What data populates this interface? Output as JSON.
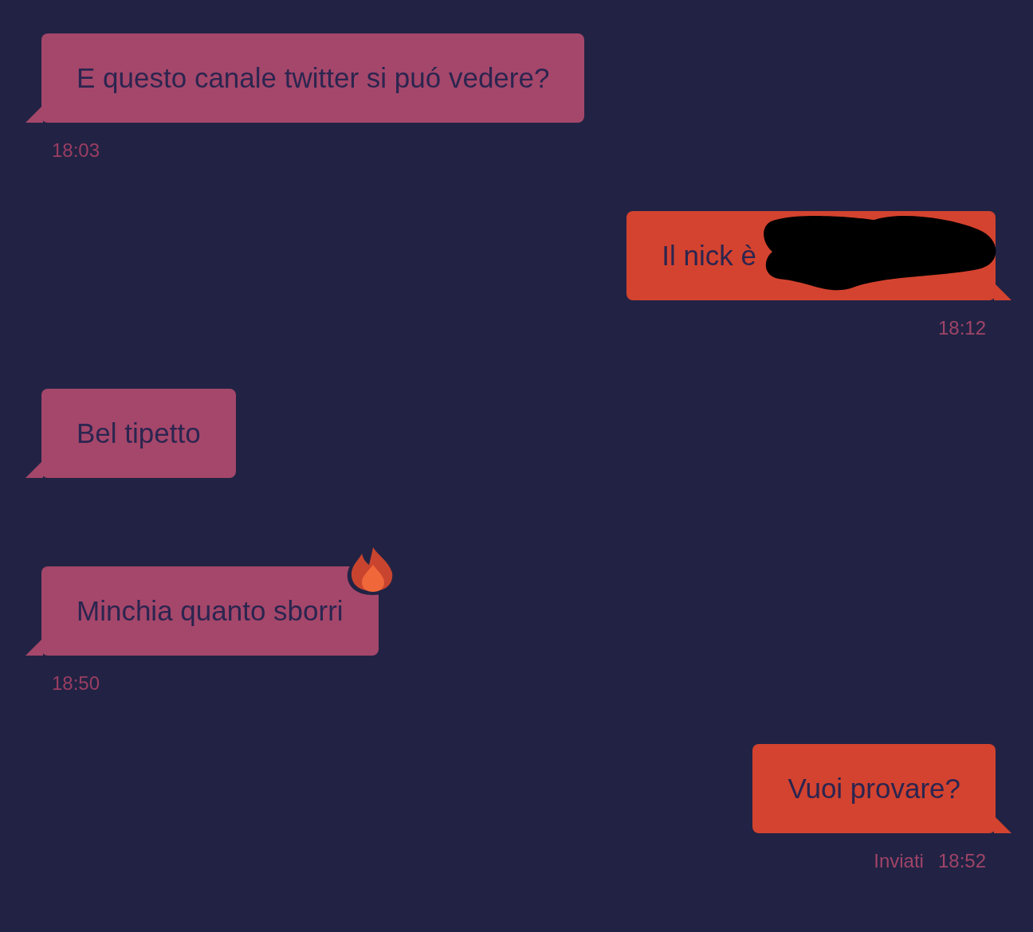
{
  "messages": [
    {
      "kind": "incoming",
      "text": "E questo canale twitter si puó vedere?",
      "time": "18:03"
    },
    {
      "kind": "outgoing",
      "text": "Il nick è",
      "redacted": true,
      "time": "18:12"
    },
    {
      "kind": "incoming",
      "text": "Bel tipetto"
    },
    {
      "kind": "incoming",
      "text": "Minchia quanto sborri",
      "fire_reaction": true,
      "time": "18:50"
    },
    {
      "kind": "outgoing",
      "text": "Vuoi provare?",
      "status": "Inviati",
      "time": "18:52"
    }
  ]
}
